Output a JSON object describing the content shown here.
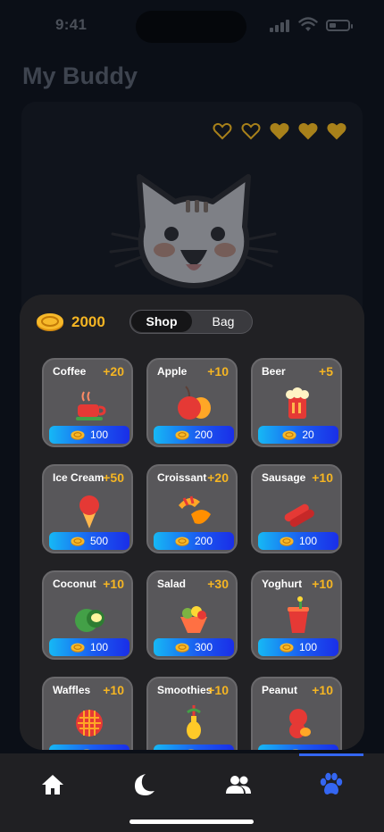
{
  "status": {
    "time": "9:41"
  },
  "page": {
    "title": "My Buddy"
  },
  "buddy": {
    "hearts_filled": 3,
    "hearts_total": 5
  },
  "shop": {
    "coins": "2000",
    "tabs": [
      {
        "label": "Shop",
        "active": true
      },
      {
        "label": "Bag",
        "active": false
      }
    ],
    "items": [
      {
        "name": "Coffee",
        "bonus": "+20",
        "price": "100",
        "icon": "coffee-icon"
      },
      {
        "name": "Apple",
        "bonus": "+10",
        "price": "200",
        "icon": "apple-icon"
      },
      {
        "name": "Beer",
        "bonus": "+5",
        "price": "20",
        "icon": "beer-icon"
      },
      {
        "name": "Ice Cream",
        "bonus": "+50",
        "price": "500",
        "icon": "ice-cream-icon"
      },
      {
        "name": "Croissant",
        "bonus": "+20",
        "price": "200",
        "icon": "croissant-icon"
      },
      {
        "name": "Sausage",
        "bonus": "+10",
        "price": "100",
        "icon": "sausage-icon"
      },
      {
        "name": "Coconut",
        "bonus": "+10",
        "price": "100",
        "icon": "coconut-icon"
      },
      {
        "name": "Salad",
        "bonus": "+30",
        "price": "300",
        "icon": "salad-icon"
      },
      {
        "name": "Yoghurt",
        "bonus": "+10",
        "price": "100",
        "icon": "yoghurt-icon"
      },
      {
        "name": "Waffles",
        "bonus": "+10",
        "price": "",
        "icon": "waffles-icon"
      },
      {
        "name": "Smoothies",
        "bonus": "+10",
        "price": "",
        "icon": "smoothie-icon"
      },
      {
        "name": "Peanut",
        "bonus": "+10",
        "price": "",
        "icon": "peanut-icon"
      }
    ]
  },
  "nav": {
    "items": [
      {
        "icon": "home-icon",
        "active": false
      },
      {
        "icon": "moon-icon",
        "active": false
      },
      {
        "icon": "friends-icon",
        "active": false
      },
      {
        "icon": "paw-icon",
        "active": true
      }
    ]
  },
  "colors": {
    "accent": "#3466f2",
    "coin": "#f5b523",
    "heart": "#a8811a"
  }
}
